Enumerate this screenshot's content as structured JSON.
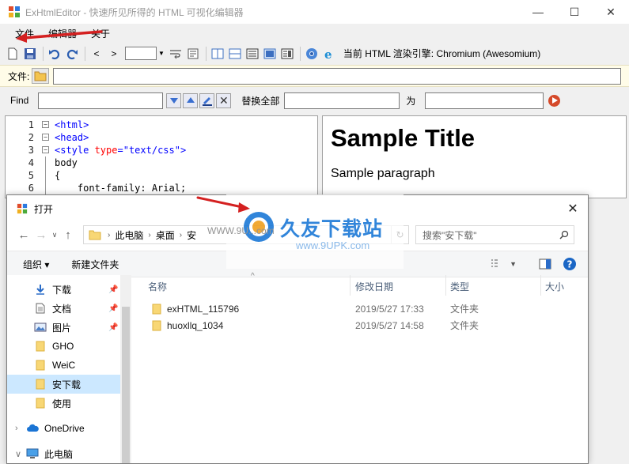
{
  "window": {
    "title": "ExHtmlEditor - 快速所见所得的 HTML 可视化编辑器",
    "controls": [
      "—",
      "☐",
      "✕"
    ]
  },
  "menu": [
    "文件",
    "编辑器",
    "关于"
  ],
  "toolbar": {
    "nav_back": "<",
    "nav_forward": ">",
    "engine_label": "当前 HTML 渲染引擎: Chromium (Awesomium)"
  },
  "filebar": {
    "label": "文件:",
    "value": ""
  },
  "findbar": {
    "find_label": "Find",
    "replace_all_label": "替换全部",
    "for_label": "为",
    "find_value": "",
    "replace_value": "",
    "for_value": ""
  },
  "editor": {
    "line_numbers": [
      "1",
      "2",
      "3",
      "4",
      "5",
      "6"
    ]
  },
  "preview": {
    "heading": "Sample Title",
    "paragraph": "Sample paragraph"
  },
  "dialog": {
    "title": "打开",
    "close": "✕",
    "breadcrumb": [
      "此电脑",
      "桌面",
      "安"
    ],
    "search_placeholder": "搜索\"安下载\"",
    "organize": "组织 ▾",
    "new_folder": "新建文件夹",
    "nav_items": [
      {
        "label": "下载",
        "icon": "download-icon",
        "pinned": true
      },
      {
        "label": "文档",
        "icon": "document-icon",
        "pinned": true
      },
      {
        "label": "图片",
        "icon": "picture-icon",
        "pinned": true
      },
      {
        "label": "GHO",
        "icon": "folder-icon",
        "pinned": false
      },
      {
        "label": "WeiC",
        "icon": "folder-icon",
        "pinned": false
      },
      {
        "label": "安下载",
        "icon": "folder-icon",
        "pinned": false,
        "selected": true
      },
      {
        "label": "使用",
        "icon": "folder-icon",
        "pinned": false
      }
    ],
    "onedrive": "OneDrive",
    "this_pc": "此电脑",
    "columns": {
      "name": "名称",
      "date": "修改日期",
      "type": "类型",
      "size": "大小"
    },
    "files": [
      {
        "name": "exHTML_115796",
        "date": "2019/5/27 17:33",
        "type": "文件夹"
      },
      {
        "name": "huoxllq_1034",
        "date": "2019/5/27 14:58",
        "type": "文件夹"
      }
    ]
  },
  "watermark": {
    "brand": "久友下载站",
    "url": "www.9UPK.com",
    "overlay_text": "WWW.9U...com"
  }
}
